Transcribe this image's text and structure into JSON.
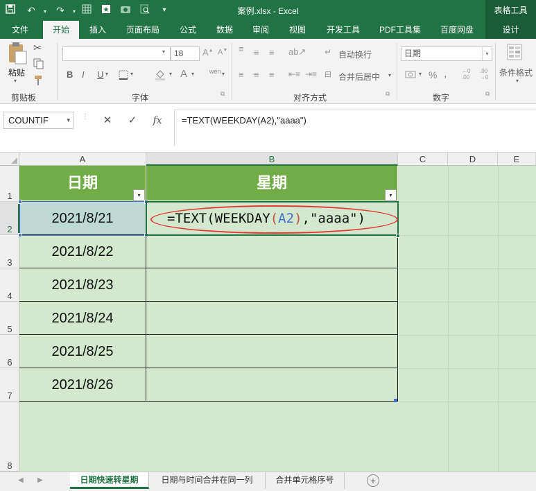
{
  "titlebar": {
    "title": "案例.xlsx - Excel",
    "context_tab": "表格工具",
    "qa_icons": [
      "save-icon",
      "undo-icon",
      "redo-icon",
      "grid-icon",
      "camera-icon",
      "preview-icon",
      "customize-icon"
    ]
  },
  "tabs": [
    "文件",
    "开始",
    "插入",
    "页面布局",
    "公式",
    "数据",
    "审阅",
    "视图",
    "开发工具",
    "PDF工具集",
    "百度网盘",
    "设计"
  ],
  "ribbon": {
    "clipboard": {
      "paste_label": "粘贴",
      "group_label": "剪贴板"
    },
    "font": {
      "font_name": "",
      "font_size": "18",
      "group_label": "字体",
      "bold": "B",
      "italic": "I",
      "underline": "U",
      "font_color": "A",
      "phonetic": "wén"
    },
    "alignment": {
      "wrap_text": "自动换行",
      "merge_center": "合并后居中",
      "group_label": "对齐方式"
    },
    "number": {
      "format": "日期",
      "percent": "%",
      "group_label": "数字"
    },
    "styles": {
      "conditional_format": "条件格式"
    }
  },
  "formula_bar": {
    "name_box": "COUNTIF",
    "cancel": "✕",
    "enter": "✓",
    "fx": "fx",
    "formula": "=TEXT(WEEKDAY(A2),\"aaaa\")"
  },
  "sheet": {
    "columns": [
      "A",
      "B",
      "C",
      "D",
      "E"
    ],
    "rows": [
      "1",
      "2",
      "3",
      "4",
      "5",
      "6",
      "7",
      "8"
    ],
    "headers": {
      "a": "日期",
      "b": "星期"
    },
    "dates": [
      "2021/8/21",
      "2021/8/22",
      "2021/8/23",
      "2021/8/24",
      "2021/8/25",
      "2021/8/26"
    ],
    "edit_formula": {
      "prefix": "=TEXT(WEEKDAY",
      "open_paren": "(",
      "ref": "A2",
      "close_paren": ")",
      "suffix": ",\"aaaa\")"
    }
  },
  "sheet_tabs": [
    "日期快速转星期",
    "日期与时间合并在同一列",
    "合并单元格序号"
  ],
  "colors": {
    "excel_green": "#217346",
    "header_fill": "#70ad47",
    "cell_fill": "#d3e8cf",
    "annotation_red": "#e03b2f"
  }
}
